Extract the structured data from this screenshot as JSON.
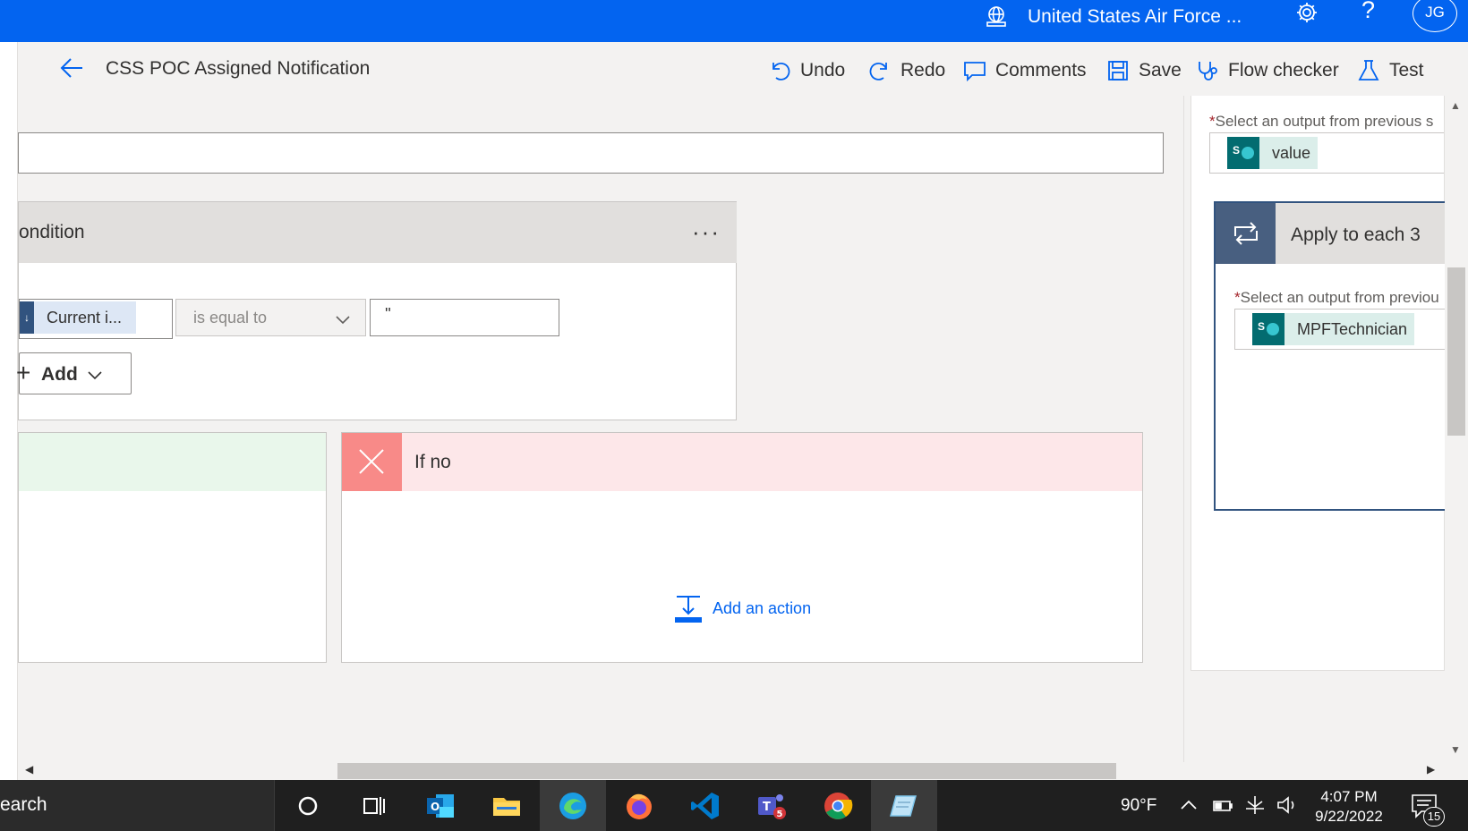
{
  "topbar": {
    "environment_label": "United States Air Force ...",
    "avatar_initials": "JG",
    "help_glyph": "?"
  },
  "commandbar": {
    "flow_title": "CSS POC Assigned Notification",
    "undo_label": "Undo",
    "redo_label": "Redo",
    "comments_label": "Comments",
    "save_label": "Save",
    "flow_checker_label": "Flow checker",
    "test_label": "Test"
  },
  "condition": {
    "title": "ondition",
    "more_glyph": "···",
    "token_label": "Current i...",
    "operator": "is equal to",
    "value": "''",
    "add_label": "Add"
  },
  "if_no": {
    "title": "If no",
    "add_action_label": "Add an action"
  },
  "right_panel": {
    "required_mark": "*",
    "select_output_label_1": "Select an output from previous s",
    "token_1": "value",
    "apply_each_title": "Apply to each 3",
    "select_output_label_2": "Select an output from previou",
    "token_2": "MPFTechnician"
  },
  "taskbar": {
    "search_text": "earch",
    "temperature": "90°F",
    "time": "4:07 PM",
    "date": "9/22/2022",
    "notification_count": "15",
    "teams_badge": "5"
  },
  "colors": {
    "brand_blue": "#0364f0",
    "if_no_header": "#fde7e9",
    "if_no_icon": "#f88a88",
    "if_yes_header": "#e9f7eb",
    "sharepoint_teal": "#036c70"
  }
}
